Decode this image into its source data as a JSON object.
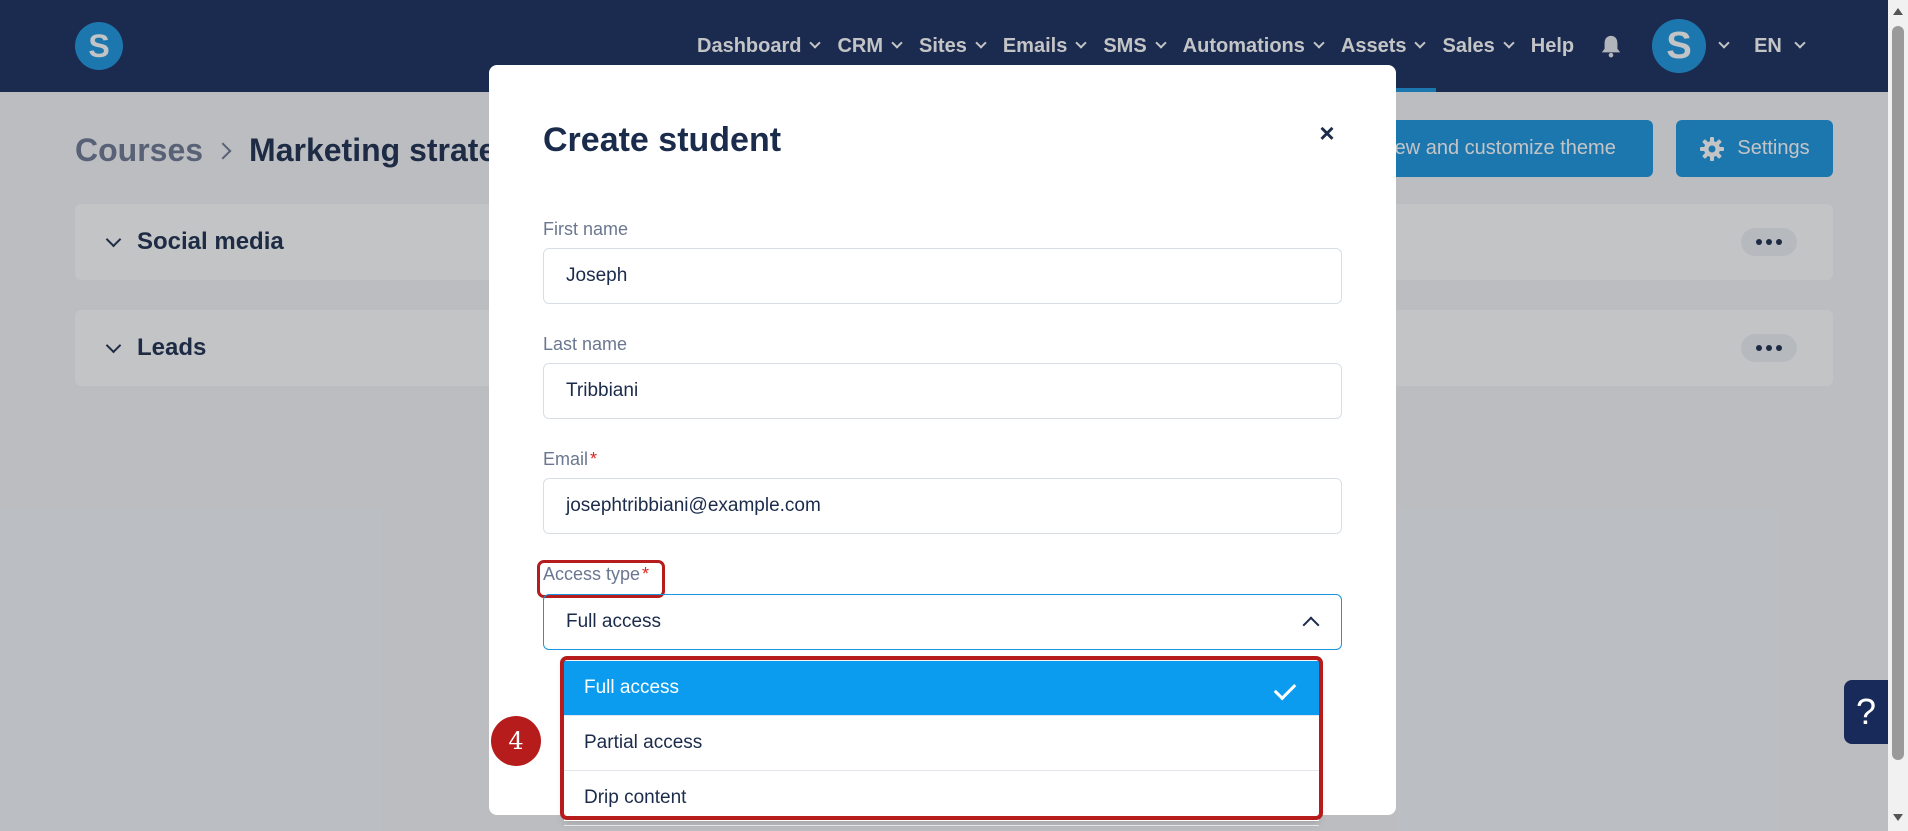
{
  "nav": {
    "logo": "S",
    "items": [
      {
        "label": "Dashboard"
      },
      {
        "label": "CRM"
      },
      {
        "label": "Sites"
      },
      {
        "label": "Emails"
      },
      {
        "label": "SMS"
      },
      {
        "label": "Automations"
      },
      {
        "label": "Assets"
      },
      {
        "label": "Sales"
      }
    ],
    "help": "Help",
    "avatar_letter": "S",
    "language": "EN",
    "active_item": "Assets"
  },
  "breadcrumb": {
    "parent": "Courses",
    "current": "Marketing strateg"
  },
  "actions": {
    "theme_button": "View and customize theme",
    "settings_button": "Settings"
  },
  "sections": [
    {
      "title": "Social media"
    },
    {
      "title": "Leads"
    }
  ],
  "modal": {
    "title": "Create student",
    "close": "×",
    "fields": {
      "first_name": {
        "label": "First name",
        "value": "Joseph"
      },
      "last_name": {
        "label": "Last name",
        "value": "Tribbiani"
      },
      "email": {
        "label": "Email",
        "required": "*",
        "value": "josephtribbiani@example.com"
      },
      "access_type": {
        "label": "Access type",
        "required": "*",
        "value": "Full access"
      }
    },
    "dropdown_options": [
      {
        "label": "Full access",
        "selected": true
      },
      {
        "label": "Partial access",
        "selected": false
      },
      {
        "label": "Drip content",
        "selected": false
      }
    ]
  },
  "annotation": {
    "step": "4"
  },
  "help_widget": "?",
  "colors": {
    "nav_bg": "#172a5a",
    "accent": "#1a95e0",
    "highlight": "#b71c1c",
    "selected_option": "#0b9cf0"
  }
}
